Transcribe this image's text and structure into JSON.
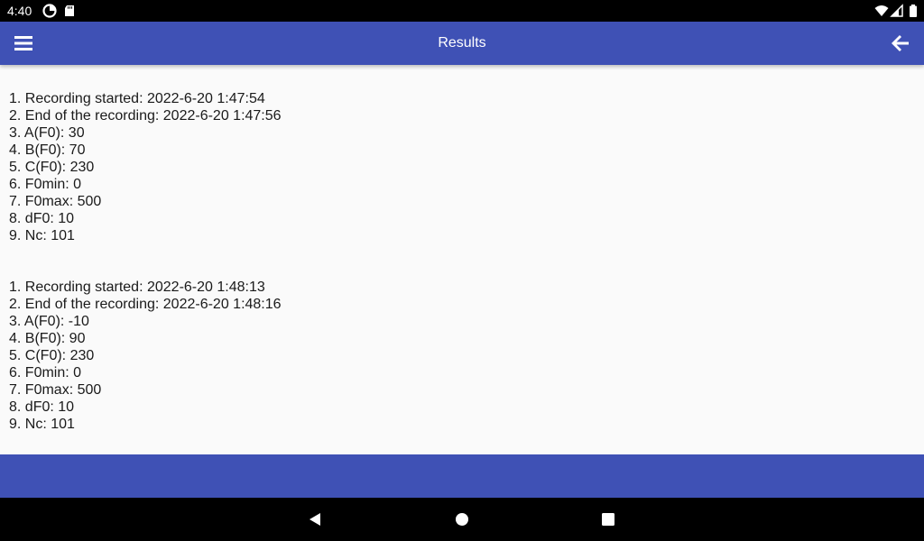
{
  "status_bar": {
    "time": "4:40",
    "icons_left": [
      "data-saver-icon",
      "sd-card-icon"
    ],
    "icons_right": [
      "wifi-icon",
      "signal-icon",
      "battery-icon"
    ]
  },
  "app_bar": {
    "title": "Results",
    "menu_icon": "hamburger-menu-icon",
    "back_icon": "arrow-back-icon",
    "color": "#3f51b5"
  },
  "records": [
    {
      "lines": [
        "1. Recording started: 2022-6-20 1:47:54",
        "2. End of the recording: 2022-6-20 1:47:56",
        "3. A(F0): 30",
        "4. B(F0): 70",
        "5. C(F0): 230",
        "6. F0min: 0",
        "7. F0max: 500",
        "8. dF0: 10",
        "9. Nc: 101"
      ]
    },
    {
      "lines": [
        "1. Recording started: 2022-6-20 1:48:13",
        "2. End of the recording: 2022-6-20 1:48:16",
        "3. A(F0): -10",
        "4. B(F0): 90",
        "5. C(F0): 230",
        "6. F0min: 0",
        "7. F0max: 500",
        "8. dF0: 10",
        "9. Nc: 101"
      ]
    }
  ],
  "bottom_bar": {
    "color": "#3f51b5"
  },
  "nav_bar": {
    "buttons": [
      "back-triangle-icon",
      "home-circle-icon",
      "recents-square-icon"
    ]
  }
}
